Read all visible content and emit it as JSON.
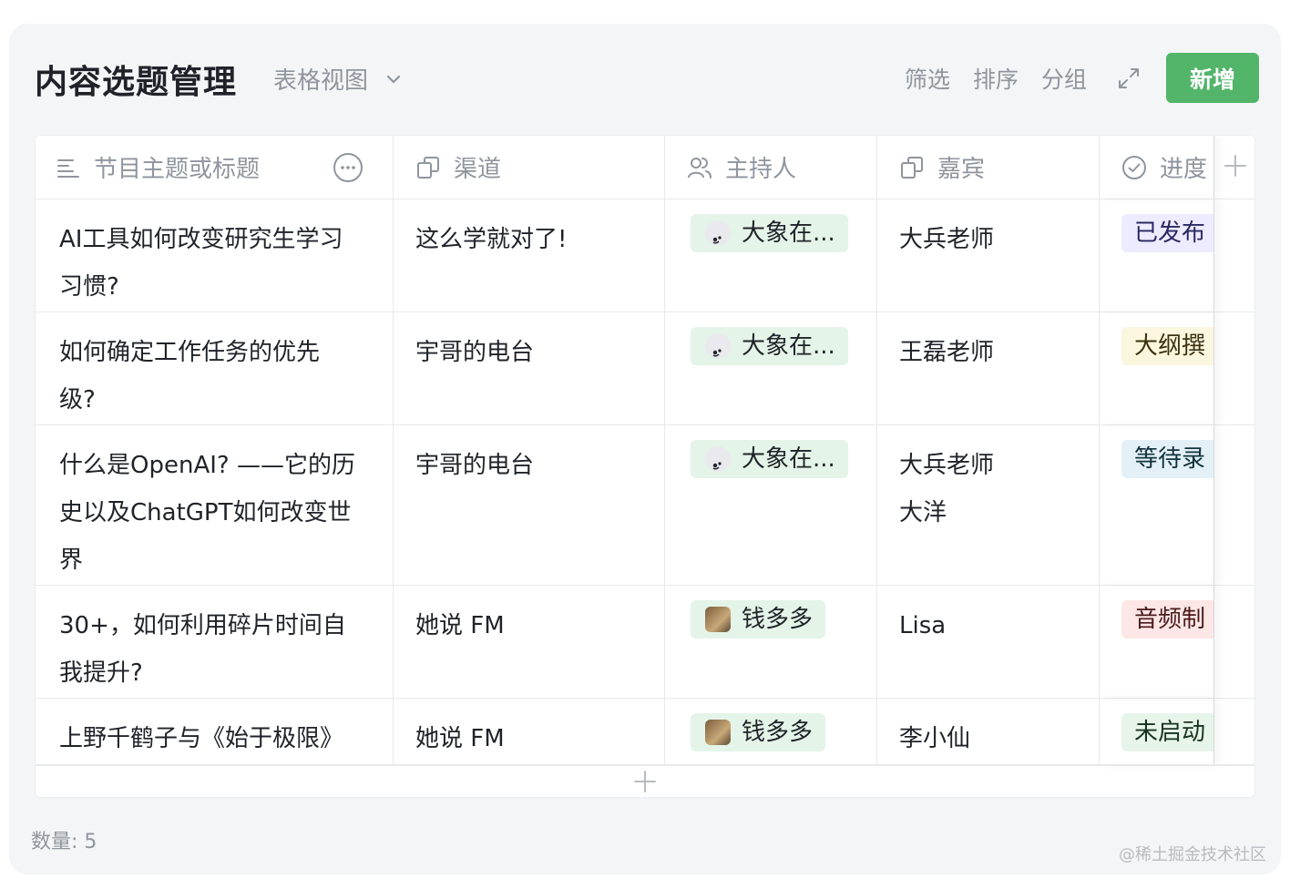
{
  "header": {
    "title": "内容选题管理",
    "view_label": "表格视图",
    "filter_label": "筛选",
    "sort_label": "排序",
    "group_label": "分组",
    "add_label": "新增"
  },
  "colors": {
    "accent": "#52b56a",
    "chip_bg": "#e4f4e8",
    "muted_text": "#8f959e"
  },
  "columns": [
    {
      "label": "节目主题或标题",
      "icon": "text-lines-icon"
    },
    {
      "label": "渠道",
      "icon": "linked-record-icon"
    },
    {
      "label": "主持人",
      "icon": "people-icon"
    },
    {
      "label": "嘉宾",
      "icon": "linked-record-icon"
    },
    {
      "label": "进度",
      "icon": "check-circle-icon"
    }
  ],
  "rows": [
    {
      "title_lines": [
        "AI工具如何改变研究生学习",
        "习惯?"
      ],
      "channel": "这么学就对了!",
      "host": "大象在...",
      "host_avatar": "elephant",
      "guest_lines": [
        "大兵老师"
      ],
      "status": "已发布",
      "status_bg": "#ecebff",
      "status_color": "#2a2860"
    },
    {
      "title_lines": [
        "如何确定工作任务的优先",
        "级?"
      ],
      "channel": "宇哥的电台",
      "host": "大象在...",
      "host_avatar": "elephant",
      "guest_lines": [
        "王磊老师"
      ],
      "status": "大纲撰",
      "status_bg": "#fbf6de",
      "status_color": "#3a3210"
    },
    {
      "title_lines": [
        "什么是OpenAI? ——它的历",
        "史以及ChatGPT如何改变世",
        "界"
      ],
      "channel": "宇哥的电台",
      "host": "大象在...",
      "host_avatar": "elephant",
      "guest_lines": [
        "大兵老师",
        "大洋"
      ],
      "status": "等待录",
      "status_bg": "#e3f1f6",
      "status_color": "#12323e"
    },
    {
      "title_lines": [
        "30+，如何利用碎片时间自",
        "我提升?"
      ],
      "channel": "她说 FM",
      "host": "钱多多",
      "host_avatar": "photo",
      "guest_lines": [
        "Lisa"
      ],
      "status": "音频制",
      "status_bg": "#fce6e6",
      "status_color": "#4a1a1a"
    },
    {
      "title_lines": [
        "上野千鹤子与《始于极限》"
      ],
      "channel": "她说 FM",
      "host": "钱多多",
      "host_avatar": "photo",
      "guest_lines": [
        "李小仙"
      ],
      "status": "未启动",
      "status_bg": "#e7f4ea",
      "status_color": "#16331f"
    }
  ],
  "footer": {
    "count_label": "数量: 5",
    "watermark": "@稀土掘金技术社区"
  }
}
